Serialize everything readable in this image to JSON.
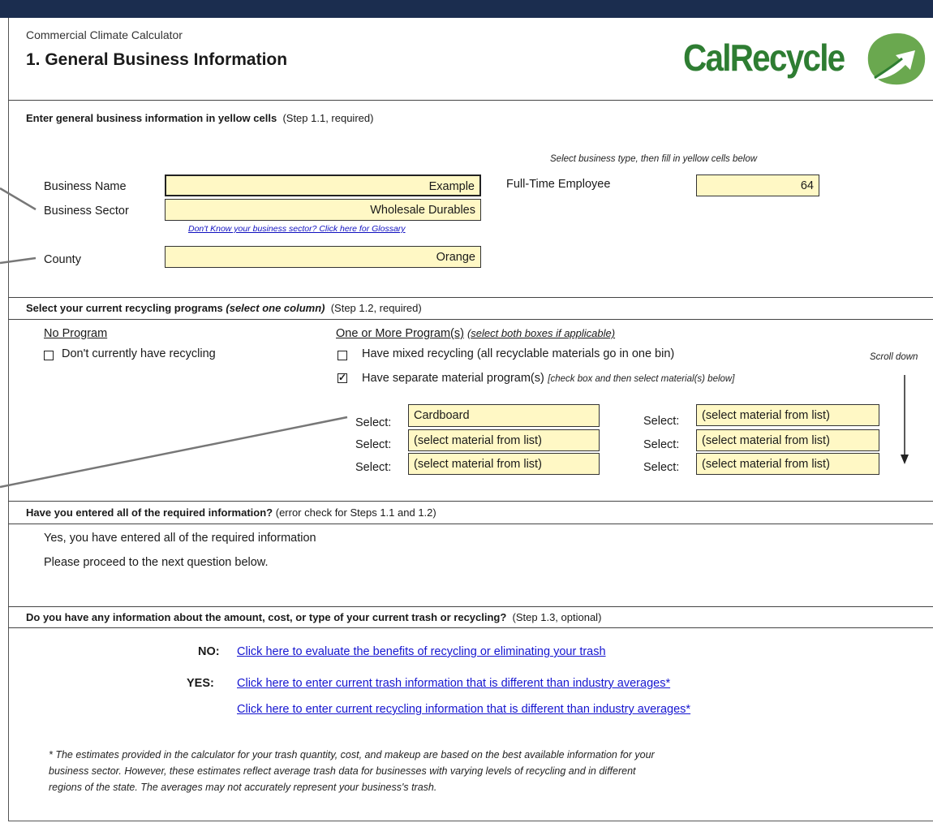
{
  "header": {
    "app_title": "Commercial Climate Calculator",
    "section_title": "1. General Business Information",
    "logo_text": "CalRecycle",
    "brand_color": "#2e7d32",
    "topbar_color": "#1b2d4f"
  },
  "step11": {
    "heading_bold": "Enter general business information in yellow cells",
    "heading_note": "(Step 1.1, required)",
    "hint": "Select business type, then fill in yellow cells below",
    "business_name_label": "Business Name",
    "business_name_value": "Example",
    "business_sector_label": "Business Sector",
    "business_sector_value": "Wholesale Durables",
    "glossary_link": "Don't Know your business sector? Click here for Glossary",
    "county_label": "County",
    "county_value": "Orange",
    "employee_label": "Full-Time Employee",
    "employee_value": "64"
  },
  "step12": {
    "heading_bold": "Select your current recycling programs",
    "heading_italic": "(select one column)",
    "heading_note": "(Step 1.2, required)",
    "no_program_header": "No Program",
    "no_recycling_label": "Don't currently have recycling",
    "one_or_more_header": "One or More Program(s)",
    "one_or_more_note": "(select both boxes if applicable)",
    "mixed_label": "Have mixed recycling (all recyclable materials go in one bin)",
    "separate_label": "Have separate material program(s)",
    "separate_note": "[check box and then select material(s) below]",
    "scroll_hint": "Scroll down",
    "select_label": "Select:",
    "selects_left": [
      "Cardboard",
      "(select material from list)",
      "(select material from list)"
    ],
    "selects_right": [
      "(select material from list)",
      "(select material from list)",
      "(select material from list)"
    ]
  },
  "check": {
    "heading_bold": "Have you entered all of the required information?",
    "heading_note": "(error check for Steps 1.1 and 1.2)",
    "line1": "Yes, you have entered all of the required information",
    "line2": "Please proceed to the next question below."
  },
  "step13": {
    "heading_bold": "Do you have any information about the amount, cost, or type of your current trash or recycling?",
    "heading_note": "(Step 1.3, optional)",
    "no_label": "NO:",
    "no_link": "Click here to evaluate the benefits of recycling or eliminating your trash",
    "yes_label": "YES:",
    "yes_link1": "Click here to enter current trash information that is different than industry averages*",
    "yes_link2": "Click here to enter current recycling information that is different than industry averages*",
    "footnote1": "* The estimates provided in the calculator for your trash quantity, cost, and makeup are based on the best available information for your",
    "footnote2": "business sector.  However, these estimates reflect average trash data for businesses with varying levels of recycling and in different",
    "footnote3": "regions of the state.  The averages may not accurately represent your business's trash."
  }
}
